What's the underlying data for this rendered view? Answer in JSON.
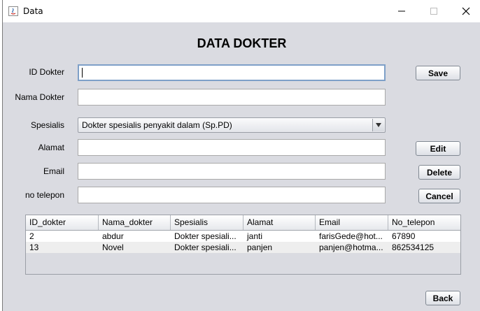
{
  "window": {
    "title": "Data"
  },
  "heading": "DATA DOKTER",
  "form": {
    "id_label": "ID Dokter",
    "id_value": "",
    "nama_label": "Nama Dokter",
    "nama_value": "",
    "spesialis_label": "Spesialis",
    "spesialis_value": "Dokter spesialis penyakit dalam (Sp.PD)",
    "alamat_label": "Alamat",
    "alamat_value": "",
    "email_label": "Email",
    "email_value": "",
    "telepon_label": "no telepon",
    "telepon_value": ""
  },
  "buttons": {
    "save": "Save",
    "edit": "Edit",
    "delete": "Delete",
    "cancel": "Cancel",
    "back": "Back"
  },
  "table": {
    "columns": [
      "ID_dokter",
      "Nama_dokter",
      "Spesialis",
      "Alamat",
      "Email",
      "No_telepon"
    ],
    "rows": [
      [
        "2",
        "abdur",
        "Dokter spesiali...",
        "janti",
        "farisGede@hot...",
        "67890"
      ],
      [
        "13",
        "Novel",
        "Dokter spesiali...",
        "panjen",
        "panjen@hotma...",
        "862534125"
      ]
    ]
  },
  "colors": {
    "client_bg": "#dadbe1",
    "focus_border": "#7ea0c8",
    "row_alt": "#eeeeee"
  }
}
